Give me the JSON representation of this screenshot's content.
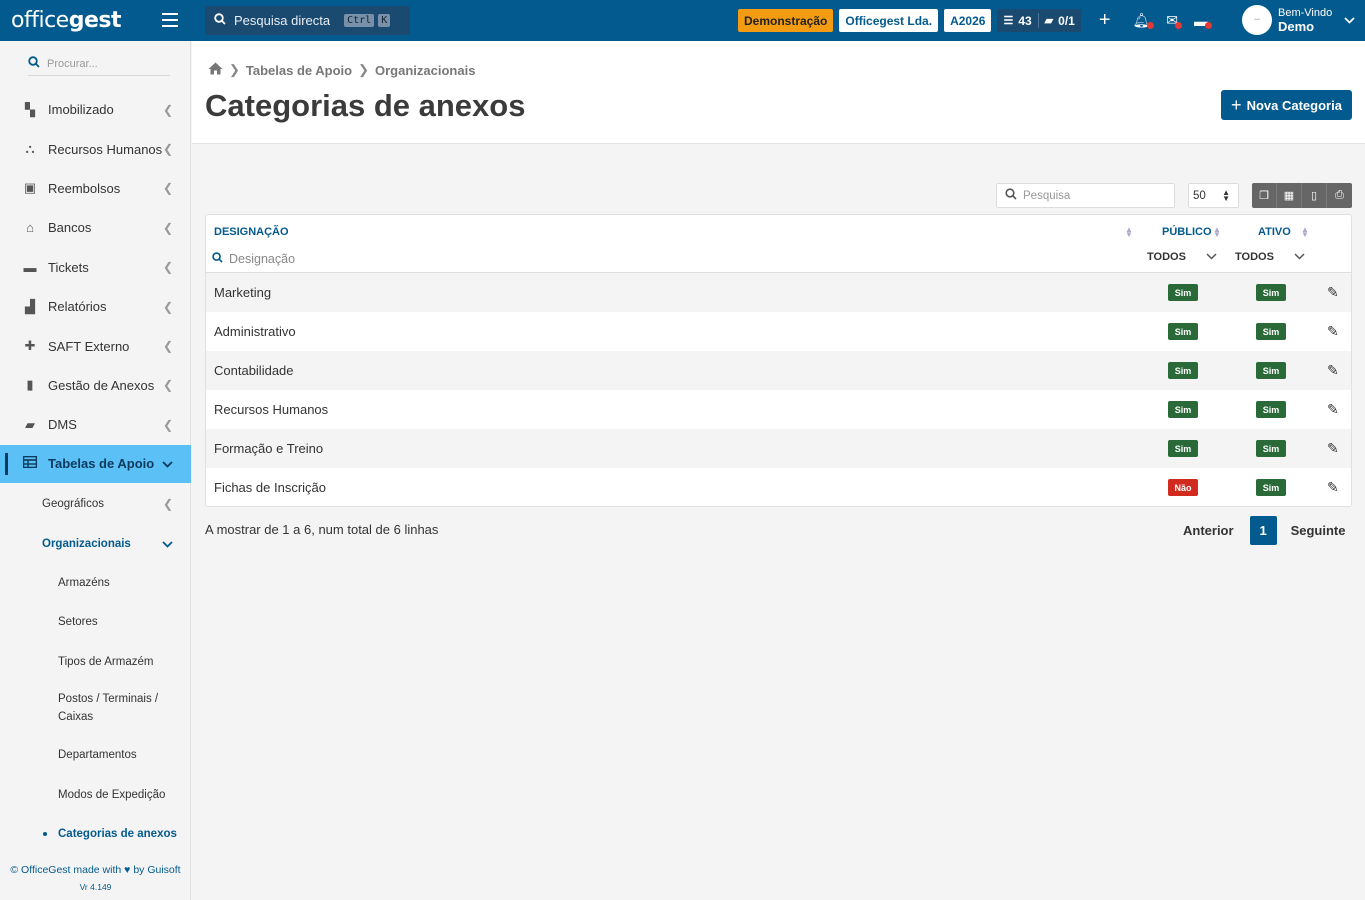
{
  "app": {
    "logo_light": "office",
    "logo_bold": "gest"
  },
  "topbar": {
    "search_placeholder": "Pesquisa directa",
    "kbd_1": "Ctrl",
    "kbd_2": "K",
    "demo_label": "Demonstração",
    "company_label": "Officegest Lda.",
    "year_label": "A2026",
    "tasks_count": "43",
    "files_count": "0/1",
    "user_greeting": "Bem-Vindo",
    "user_name": "Demo"
  },
  "sidebar": {
    "search_placeholder": "Procurar...",
    "items": [
      {
        "label": "Imobilizado",
        "icon": "briefcase-icon"
      },
      {
        "label": "Recursos Humanos",
        "icon": "org-chart-icon"
      },
      {
        "label": "Reembolsos",
        "icon": "money-icon"
      },
      {
        "label": "Bancos",
        "icon": "bank-icon"
      },
      {
        "label": "Tickets",
        "icon": "ticket-icon"
      },
      {
        "label": "Relatórios",
        "icon": "chart-icon"
      },
      {
        "label": "SAFT Externo",
        "icon": "puzzle-icon"
      },
      {
        "label": "Gestão de Anexos",
        "icon": "file-icon"
      },
      {
        "label": "DMS",
        "icon": "folder-icon"
      },
      {
        "label": "Tabelas de Apoio",
        "icon": "table-icon"
      }
    ],
    "sub_items": [
      {
        "label": "Geográficos"
      },
      {
        "label": "Organizacionais"
      }
    ],
    "sub_sub_items": [
      {
        "label": "Armazéns"
      },
      {
        "label": "Setores"
      },
      {
        "label": "Tipos de Armazém"
      },
      {
        "label": "Postos / Terminais / Caixas"
      },
      {
        "label": "Departamentos"
      },
      {
        "label": "Modos de Expedição"
      },
      {
        "label": "Categorias de anexos"
      }
    ],
    "footer_line1_a": "© OfficeGest made with",
    "footer_line1_b": "by Guisoft",
    "footer_version": "Vr 4.149"
  },
  "header": {
    "breadcrumb": [
      "Tabelas de Apoio",
      "Organizacionais"
    ],
    "title": "Categorias de anexos",
    "new_button": "Nova Categoria"
  },
  "table_tools": {
    "search_placeholder": "Pesquisa",
    "page_size": "50"
  },
  "table": {
    "columns": {
      "designation": "DESIGNAÇÃO",
      "public": "PÚBLICO",
      "active": "ATIVO"
    },
    "filter_placeholder": "Designação",
    "filter_public": "TODOS",
    "filter_active": "TODOS",
    "rows": [
      {
        "name": "Marketing",
        "public": "Sim",
        "active": "Sim"
      },
      {
        "name": "Administrativo",
        "public": "Sim",
        "active": "Sim"
      },
      {
        "name": "Contabilidade",
        "public": "Sim",
        "active": "Sim"
      },
      {
        "name": "Recursos Humanos",
        "public": "Sim",
        "active": "Sim"
      },
      {
        "name": "Formação e Treino",
        "public": "Sim",
        "active": "Sim"
      },
      {
        "name": "Fichas de Inscrição",
        "public": "Não",
        "active": "Sim"
      }
    ]
  },
  "footer": {
    "summary": "A mostrar de 1 a 6, num total de 6 linhas",
    "prev": "Anterior",
    "current_page": "1",
    "next": "Seguinte"
  },
  "colors": {
    "primary": "#035a8e",
    "active_nav": "#5bc0f5",
    "badge_green": "#2a6a38",
    "badge_red": "#d12b1f",
    "demo_orange": "#f39c12"
  }
}
